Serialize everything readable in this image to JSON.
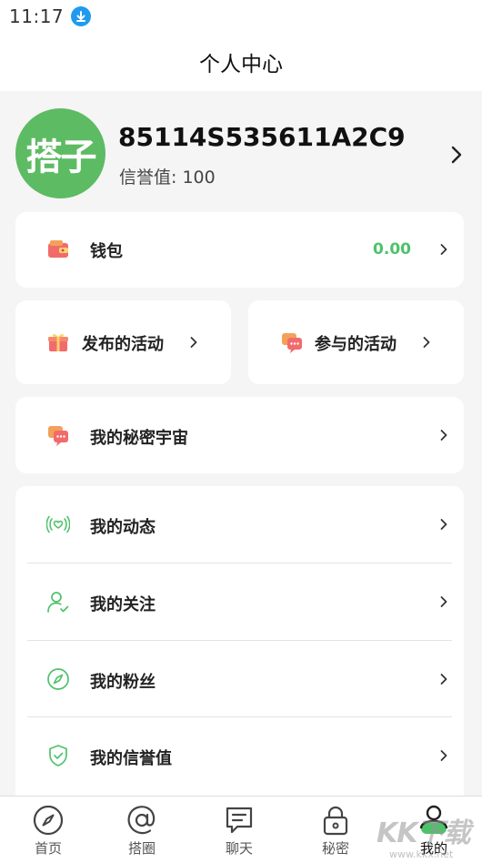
{
  "status_bar": {
    "time": "11:17",
    "download_icon": "download-arrow-icon"
  },
  "header": {
    "title": "个人中心"
  },
  "profile": {
    "avatar_text": "搭子",
    "user_id": "85114S535611A2C9",
    "reputation": "信誉值: 100"
  },
  "wallet": {
    "label": "钱包",
    "value": "0.00",
    "icon": "wallet-icon"
  },
  "activities": {
    "published": {
      "label": "发布的活动",
      "icon": "gift-icon"
    },
    "joined": {
      "label": "参与的活动",
      "icon": "chat-bubbles-icon"
    }
  },
  "secret_universe": {
    "label": "我的秘密宇宙",
    "icon": "chat-bubbles-icon"
  },
  "menu": [
    {
      "label": "我的动态",
      "icon": "broadcast-heart-icon"
    },
    {
      "label": "我的关注",
      "icon": "user-check-icon"
    },
    {
      "label": "我的粉丝",
      "icon": "compass-icon"
    },
    {
      "label": "我的信誉值",
      "icon": "shield-check-icon"
    }
  ],
  "tabs": [
    {
      "label": "首页",
      "icon": "compass-icon"
    },
    {
      "label": "搭圈",
      "icon": "at-icon"
    },
    {
      "label": "聊天",
      "icon": "message-icon"
    },
    {
      "label": "秘密",
      "icon": "lock-icon"
    },
    {
      "label": "我的",
      "icon": "user-icon",
      "active": true
    }
  ],
  "watermark": {
    "text": "KK下载",
    "url": "www.kkx.net"
  },
  "colors": {
    "accent": "#4ec26b",
    "avatar_bg": "#5dbb63",
    "background": "#f5f5f5"
  }
}
